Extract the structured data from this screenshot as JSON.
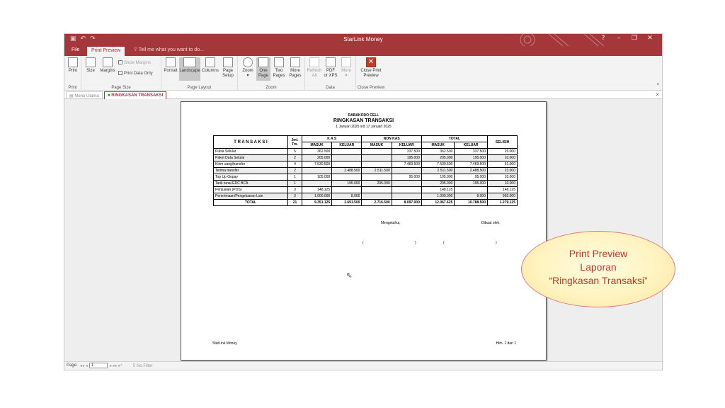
{
  "titlebar": {
    "title": "StarLink Money",
    "qat_icons": [
      "save-icon",
      "undo-icon",
      "redo-icon"
    ],
    "help": "?",
    "minimize": "–",
    "restore": "❐",
    "close": "✕"
  },
  "tabs": {
    "file": "File",
    "print_preview": "Print Preview",
    "tell_me": "Tell me what you want to do..."
  },
  "ribbon": {
    "print": {
      "print": "Print",
      "group": "Print"
    },
    "page_size": {
      "size": "Size",
      "margins": "Margins",
      "show_margins": "Show Margins",
      "print_data_only": "Print Data Only",
      "group": "Page Size"
    },
    "page_layout": {
      "portrait": "Portrait",
      "landscape": "Landscape",
      "columns": "Columns",
      "page_setup_1": "Page",
      "page_setup_2": "Setup",
      "group": "Page Layout"
    },
    "zoom": {
      "zoom": "Zoom",
      "one_page_1": "One",
      "one_page_2": "Page",
      "two_pages_1": "Two",
      "two_pages_2": "Pages",
      "more_pages_1": "More",
      "more_pages_2": "Pages",
      "group": "Zoom"
    },
    "data": {
      "refresh_1": "Refresh",
      "refresh_2": "All",
      "pdf_1": "PDF",
      "pdf_2": "or XPS",
      "more": "More",
      "group": "Data"
    },
    "close_preview": {
      "label_1": "Close Print",
      "label_2": "Preview",
      "group": "Close Preview"
    }
  },
  "doc_tabs": {
    "menu_utama": "Menu Utama",
    "ringkasan": "RINGKASAN TRANSAKSI"
  },
  "report": {
    "company": "RABAKODO CELL",
    "title": "RINGKASAN TRANSAKSI",
    "period": "1 Januari 2025 s/d 17 Januari 2025",
    "headers": {
      "transaksi": "T R A N S A K S I",
      "jml_1": "Jml.",
      "jml_2": "Trx.",
      "kas": "K A S",
      "non_kas": "NON KAS",
      "total": "TOTAL",
      "selisih": "SELISIH",
      "masuk": "MASUK",
      "keluar": "KELUAR"
    },
    "rows": [
      [
        "Pulsa Selular",
        "5",
        "362.500",
        "",
        "",
        "337.500",
        "362.500",
        "337.500",
        "25.000"
      ],
      [
        "Paket Data Selular",
        "2",
        "205.000",
        "",
        "",
        "195.000",
        "205.000",
        "195.000",
        "10.000"
      ],
      [
        "Kirim uang/transfer",
        "4",
        "7.530.500",
        "",
        "",
        "7.469.500",
        "7.530.500",
        "7.469.500",
        "61.000"
      ],
      [
        "Terima transfer",
        "2",
        "",
        "2.488.500",
        "2.511.500",
        "",
        "2.511.500",
        "2.488.500",
        "23.000"
      ],
      [
        "Top Up Gopay",
        "1",
        "105.000",
        "",
        "",
        "95.000",
        "105.000",
        "95.000",
        "10.000"
      ],
      [
        "Tarik tunai EDC BCA",
        "1",
        "",
        "195.000",
        "205.000",
        "",
        "205.000",
        "195.000",
        "10.000"
      ],
      [
        "Penjualan (POS)",
        "3",
        "148.125",
        "",
        "",
        "",
        "148.125",
        "",
        "148.125"
      ],
      [
        "Penerimaan/Pengeluaran Lain",
        "3",
        "1.000.000",
        "8.000",
        "",
        "",
        "1.000.000",
        "8.000",
        "992.000"
      ]
    ],
    "total_row": [
      "TOTAL",
      "21",
      "9.351.125",
      "2.691.500",
      "2.716.500",
      "8.097.000",
      "12.067.625",
      "10.788.500",
      "1.279.125"
    ],
    "mengetahui": "Mengetahui,",
    "dibuat_oleh": "Dibuat oleh,",
    "paren_open": "(",
    "paren_close": ")",
    "footer_left": "StarLink Money",
    "footer_right": "Hlm. 1 dari 1"
  },
  "statusbar": {
    "page_label": "Page:",
    "page_value": "1",
    "nav_left": "◂◂ ◂",
    "nav_right": "▸ ▸▸ ▸*",
    "filter": "No Filter"
  },
  "callout": {
    "line1": "Print Preview",
    "line2": "Laporan",
    "line3": "“Ringkasan Transaksi”"
  },
  "colors": {
    "accent": "#a4373a",
    "callout_text": "#c0392b"
  }
}
